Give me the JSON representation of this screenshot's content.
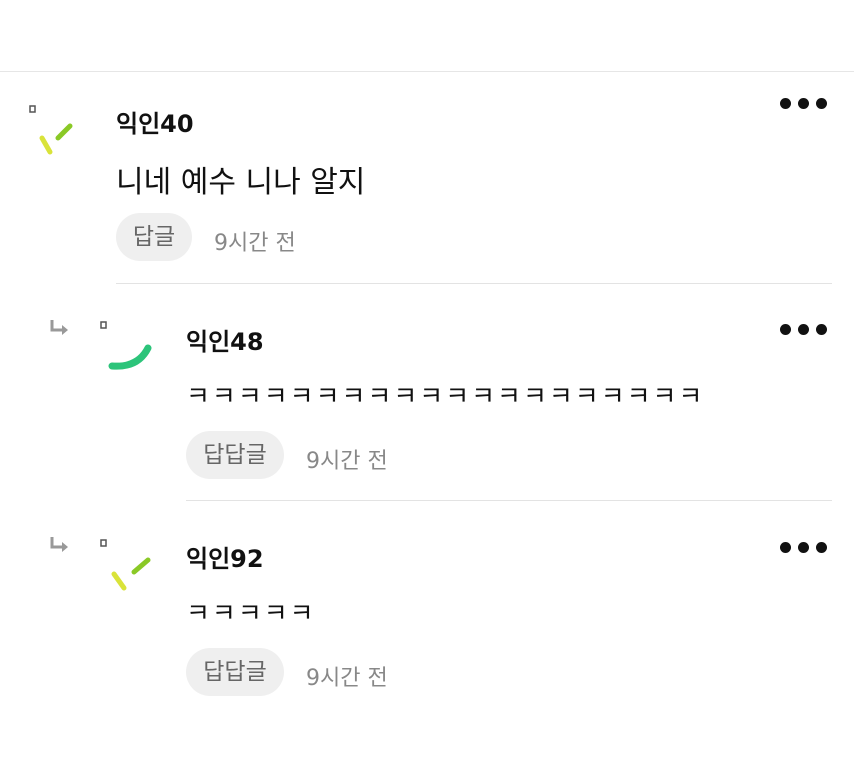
{
  "comments": [
    {
      "author": "익인40",
      "text": "니네 예수 니나 알지",
      "reply_label": "답글",
      "time": "9시간 전",
      "is_reply": false
    },
    {
      "author": "익인48",
      "text": "ㅋㅋㅋㅋㅋㅋㅋㅋㅋㅋㅋㅋㅋㅋㅋㅋㅋㅋㅋㅋ",
      "reply_label": "답답글",
      "time": "9시간 전",
      "is_reply": true
    },
    {
      "author": "익인92",
      "text": "ㅋㅋㅋㅋㅋ",
      "reply_label": "답답글",
      "time": "9시간 전",
      "is_reply": true
    }
  ],
  "colors": {
    "accent_green": "#2cc47a",
    "accent_lime": "#8ac926",
    "accent_yellow": "#d9e33a"
  },
  "icons": {
    "more": "more-dots-icon",
    "reply_arrow": "reply-arrow-icon",
    "avatar": "avatar-icon"
  }
}
